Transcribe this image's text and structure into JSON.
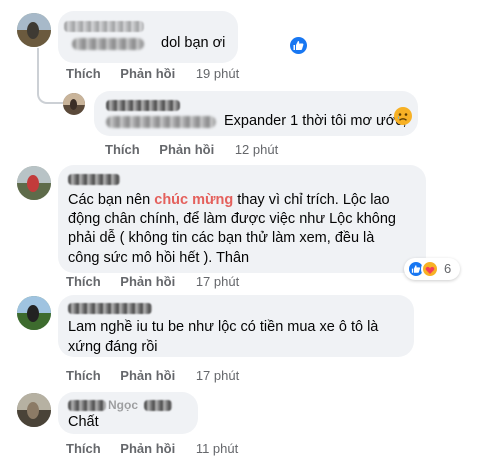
{
  "comments": [
    {
      "text_visible": "dol bạn ơi",
      "actions": {
        "like": "Thích",
        "reply": "Phản hồi",
        "time": "19 phút"
      }
    },
    {
      "text_visible": "Expander 1 thời tôi mơ ước,",
      "actions": {
        "like": "Thích",
        "reply": "Phản hồi",
        "time": "12 phút"
      }
    },
    {
      "text_before": "Các bạn nên ",
      "text_highlight": "chúc mừng",
      "text_after": " thay vì chỉ trích. Lộc lao động chân chính, để làm được việc như Lộc không phải dễ ( không tin các bạn thử làm xem, đều là công sức mô hồi hết ). Thân",
      "reaction_count": "6",
      "actions": {
        "like": "Thích",
        "reply": "Phản hồi",
        "time": "17 phút"
      }
    },
    {
      "text": "Lam nghề iu tu be như lộc có tiền mua xe ô tô là xứng đáng rồi",
      "actions": {
        "like": "Thích",
        "reply": "Phản hồi",
        "time": "17 phút"
      }
    },
    {
      "name_partial": "Ngọc",
      "text": "Chất",
      "actions": {
        "like": "Thích",
        "reply": "Phản hồi",
        "time": "11 phút"
      }
    }
  ],
  "colors": {
    "bubble": "#f0f2f5",
    "action_text": "#65676b",
    "highlight": "#e4605c",
    "like_blue": "#1877f2"
  },
  "icons": [
    "like-reaction-icon",
    "sad-reaction-icon",
    "love-reaction-icon",
    "care-reaction-icon"
  ]
}
